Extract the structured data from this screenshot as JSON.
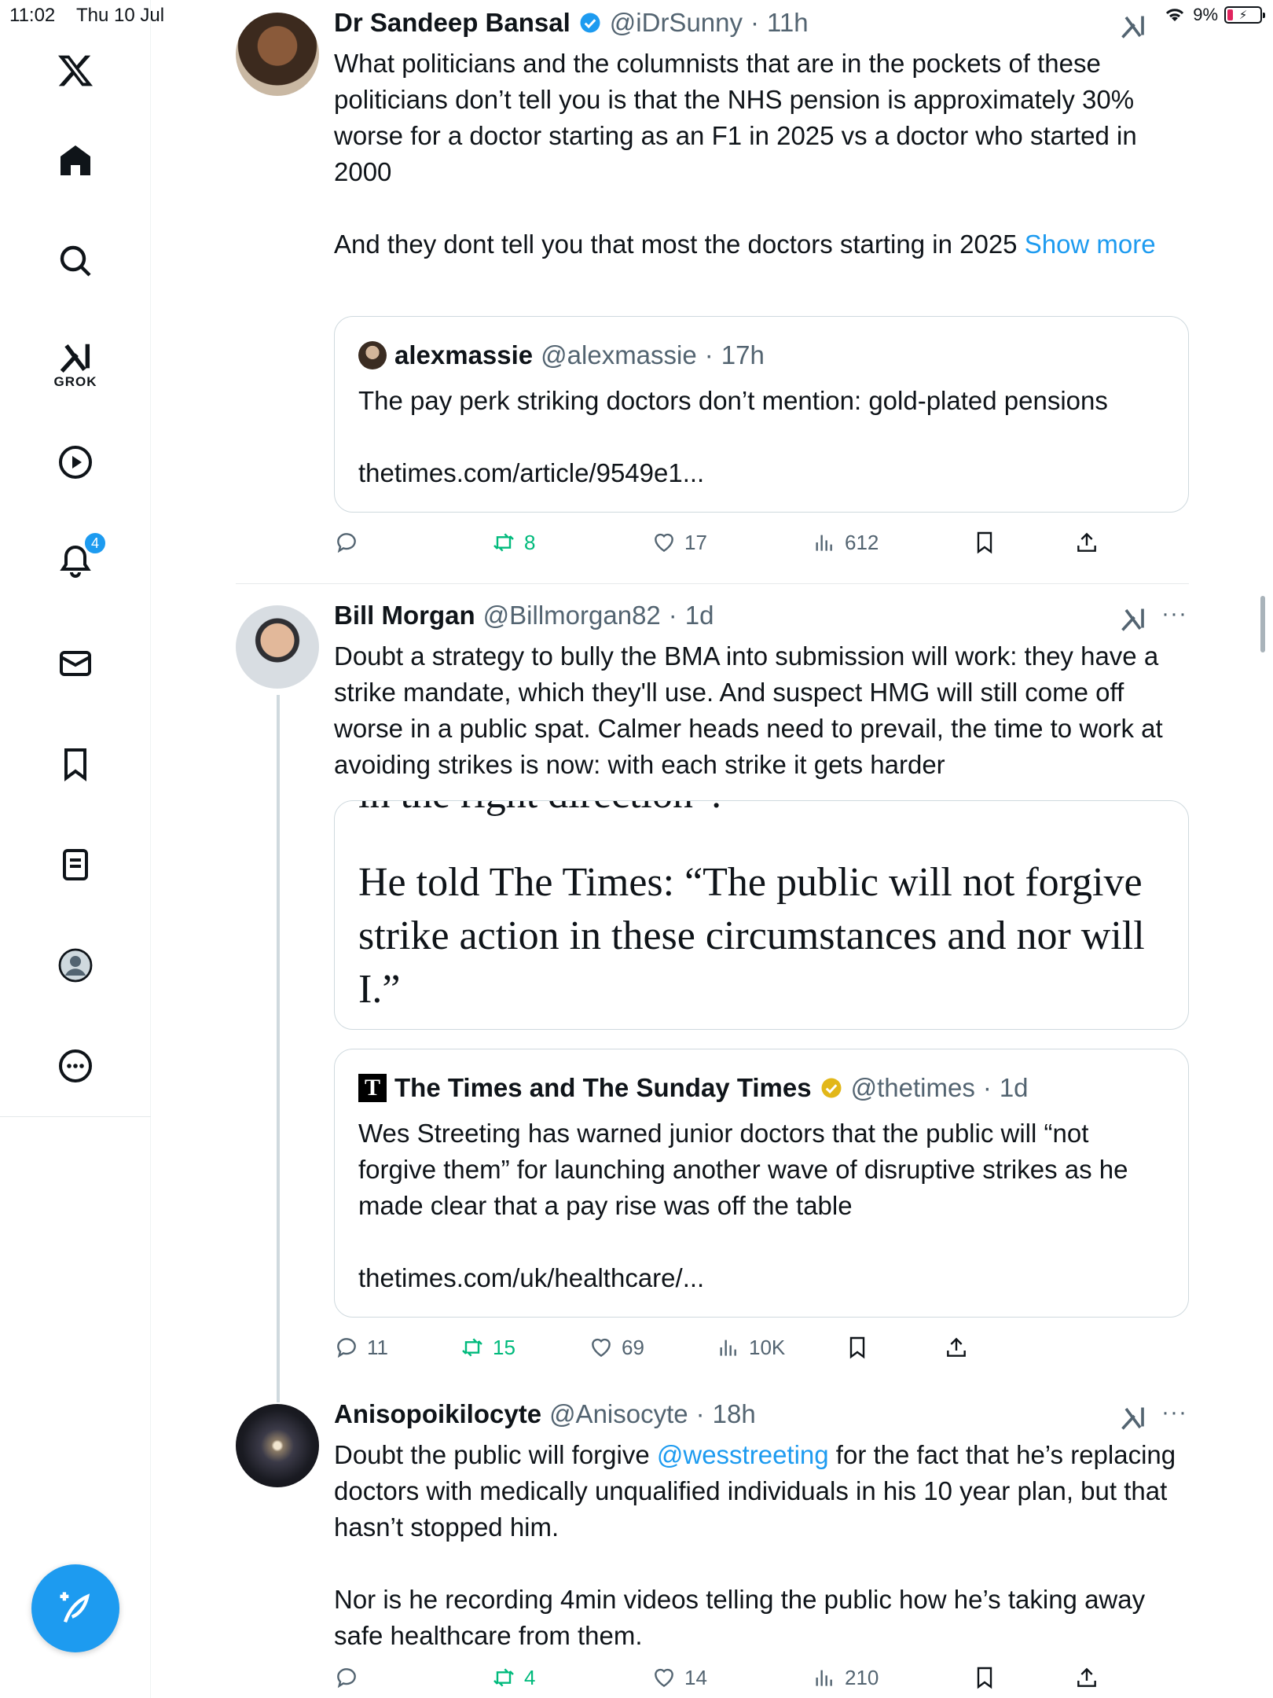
{
  "status_bar": {
    "time": "11:02",
    "date": "Thu 10 Jul",
    "battery": "9%"
  },
  "sidebar": {
    "grok_label": "GROK",
    "notifications_badge": "4"
  },
  "tweets": [
    {
      "name": "Dr Sandeep Bansal",
      "handle": "@iDrSunny",
      "time": "11h",
      "text": "What politicians and the columnists that are in the pockets of these politicians don’t tell you is that the NHS pension is approximately 30% worse for a doctor starting as an F1 in 2025 vs a doctor who started in 2000\n\nAnd they dont tell you that most the doctors starting in 2025 ",
      "show_more": "Show more",
      "quote": {
        "name": "alexmassie",
        "handle": "@alexmassie",
        "time": "17h",
        "text": "The pay perk striking doctors don’t mention: gold-plated pensions",
        "link": "thetimes.com/article/9549e1..."
      },
      "actions": {
        "replies": "",
        "retweets": "8",
        "likes": "17",
        "views": "612"
      }
    },
    {
      "name": "Bill Morgan",
      "handle": "@Billmorgan82",
      "time": "1d",
      "text": "Doubt a strategy to bully the BMA into submission will work: they have a strike mandate, which they'll use. And suspect HMG will still come off worse in a public spat. Calmer heads need to prevail, the time to work at avoiding strikes is now: with each strike it gets harder",
      "image_quote": "He told The Times: “The public will not forgive strike action in these circumstances and nor will I.”",
      "image_quote_cut": "in the right direction”.",
      "quote": {
        "name": "The Times and The Sunday Times",
        "logo_letter": "T",
        "handle": "@thetimes",
        "time": "1d",
        "text": "Wes Streeting has warned junior doctors that the public will “not forgive them” for launching another wave of disruptive strikes as he made clear that a pay rise was off the table",
        "link": "thetimes.com/uk/healthcare/..."
      },
      "actions": {
        "replies": "11",
        "retweets": "15",
        "likes": "69",
        "views": "10K"
      }
    },
    {
      "name": "Anisopoikilocyte",
      "handle": "@Anisocyte",
      "time": "18h",
      "text_before": "Doubt the public will forgive ",
      "mention": "@wesstreeting",
      "text_after": " for the fact that he’s replacing doctors with medically unqualified individuals in his 10 year plan, but that hasn’t stopped him.\n\nNor is he recording 4min videos telling the public how he’s taking away safe healthcare from them.",
      "actions": {
        "replies": "",
        "retweets": "4",
        "likes": "14",
        "views": "210"
      }
    }
  ],
  "colors": {
    "accent": "#1d9bf0",
    "retweet": "#00ba7c",
    "muted": "#536471",
    "gold": "#e2b719"
  }
}
